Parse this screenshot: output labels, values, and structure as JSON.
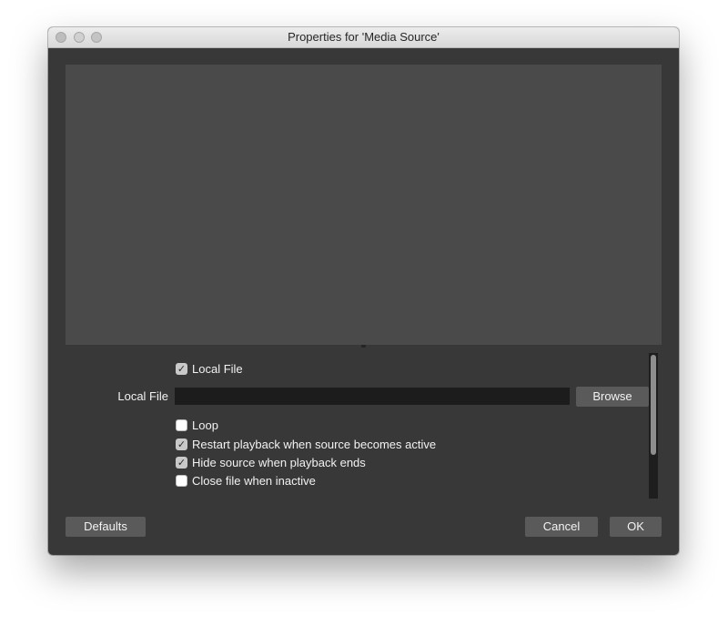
{
  "window": {
    "title": "Properties for 'Media Source'"
  },
  "properties": {
    "local_file_checkbox": {
      "label": "Local File",
      "checked": true
    },
    "local_file_field": {
      "label": "Local File",
      "value": "",
      "browse_label": "Browse"
    },
    "loop": {
      "label": "Loop",
      "checked": false
    },
    "restart_playback": {
      "label": "Restart playback when source becomes active",
      "checked": true
    },
    "hide_source": {
      "label": "Hide source when playback ends",
      "checked": true
    },
    "close_file": {
      "label": "Close file when inactive",
      "checked": false
    }
  },
  "footer": {
    "defaults_label": "Defaults",
    "cancel_label": "Cancel",
    "ok_label": "OK"
  },
  "colors": {
    "window_bg": "#383838",
    "preview_bg": "#4a4a4a",
    "button_bg": "#5a5a5a",
    "input_bg": "#1c1c1c",
    "text": "#f2f2f2"
  },
  "icons": {
    "check": "✓"
  }
}
